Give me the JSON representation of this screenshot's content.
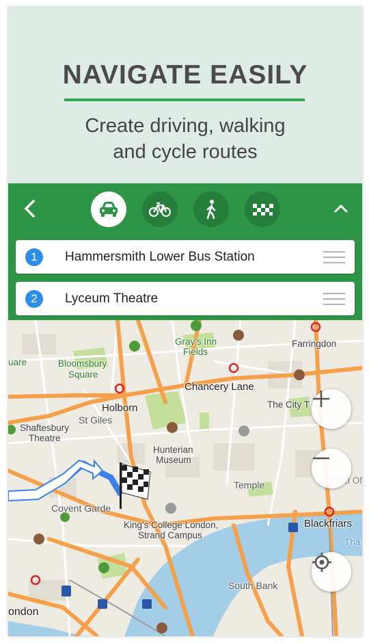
{
  "hero": {
    "title": "NAVIGATE EASILY",
    "subtitle_line1": "Create driving, walking",
    "subtitle_line2": "and cycle routes"
  },
  "toolbar": {
    "modes": [
      {
        "name": "car",
        "icon": "car-icon",
        "active": true
      },
      {
        "name": "bike",
        "icon": "bike-icon",
        "active": false
      },
      {
        "name": "walk",
        "icon": "walk-icon",
        "active": false
      },
      {
        "name": "taxi",
        "icon": "taxi-icon",
        "active": false
      }
    ]
  },
  "route": {
    "stops": [
      {
        "number": "1",
        "name": "Hammersmith Lower Bus Station"
      },
      {
        "number": "2",
        "name": "Lyceum Theatre"
      }
    ]
  },
  "map": {
    "labels": {
      "farringdon": "Farringdon",
      "grays_inn_1": "Gray's Inn",
      "grays_inn_2": "Fields",
      "bloomsbury_1": "Bloomsbury",
      "bloomsbury_2": "Square",
      "chancery": "Chancery Lane",
      "city": "The City T",
      "holborn": "Holborn",
      "stgiles": "St Giles",
      "shaftesbury_1": "Shaftesbury",
      "shaftesbury_2": "Theatre",
      "hunterian_1": "Hunterian",
      "hunterian_2": "Museum",
      "temple": "Temple",
      "bechtel": "Bechtel Offi",
      "covent": "Covent Garde",
      "kings_1": "King's College London,",
      "kings_2": "Strand Campus",
      "blackfriars": "Blackfriars",
      "southbank": "South Bank",
      "london": "ondon",
      "uare": "uare",
      "tha": "Tha"
    }
  },
  "colors": {
    "primary_green": "#2e9546",
    "dark_green": "#267e3b",
    "stop_badge": "#2d8ee9",
    "route_blue": "#3b82e8",
    "water": "#a4cde8",
    "park": "#c4df9b",
    "road_major": "#f5a04a"
  }
}
